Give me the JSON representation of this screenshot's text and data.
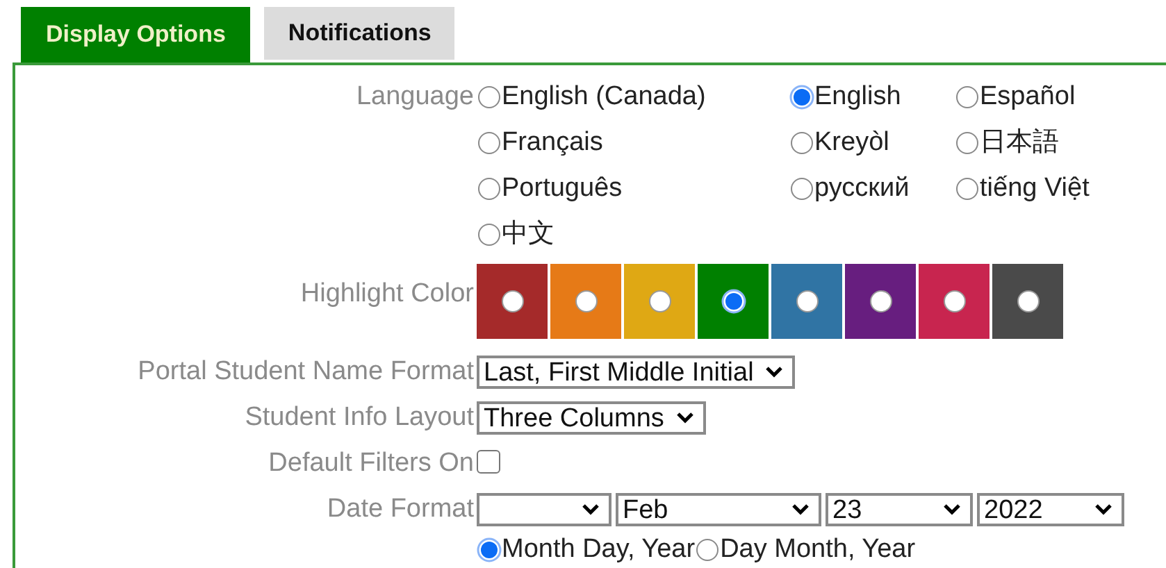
{
  "tabs": [
    {
      "label": "Display Options",
      "selected": true
    },
    {
      "label": "Notifications",
      "selected": false
    }
  ],
  "fields": [
    {
      "kind": "radio_group",
      "label": "Language",
      "options": [
        {
          "label": "English (Canada)",
          "selected": false
        },
        {
          "label": "English",
          "selected": true
        },
        {
          "label": "Español",
          "selected": false
        },
        {
          "label": "Français",
          "selected": false
        },
        {
          "label": "Kreyòl",
          "selected": false
        },
        {
          "label": "日本語",
          "selected": false
        },
        {
          "label": "Português",
          "selected": false
        },
        {
          "label": "русский",
          "selected": false
        },
        {
          "label": "tiếng Việt",
          "selected": false
        },
        {
          "label": "中文",
          "selected": false
        }
      ]
    },
    {
      "kind": "swatches",
      "label": "Highlight Color",
      "options": [
        {
          "color": "#a52a2a",
          "selected": false
        },
        {
          "color": "#e67a17",
          "selected": false
        },
        {
          "color": "#dfa814",
          "selected": false
        },
        {
          "color": "#008000",
          "selected": true
        },
        {
          "color": "#3074a4",
          "selected": false
        },
        {
          "color": "#671e7f",
          "selected": false
        },
        {
          "color": "#c8254f",
          "selected": false
        },
        {
          "color": "#4a4a4a",
          "selected": false
        }
      ]
    },
    {
      "kind": "select",
      "label": "Portal Student Name Format",
      "value": "Last, First Middle Initial"
    },
    {
      "kind": "select",
      "label": "Student Info Layout",
      "value": "Three Columns"
    },
    {
      "kind": "checkbox",
      "label": "Default Filters On",
      "checked": false
    },
    {
      "kind": "date",
      "label": "Date Format",
      "selects": [
        {
          "empty": true
        },
        {
          "value": "Feb"
        },
        {
          "value": "23"
        },
        {
          "value": "2022"
        }
      ],
      "options": [
        {
          "label": "Month Day, Year",
          "selected": true
        },
        {
          "label": "Day Month, Year",
          "selected": false
        }
      ]
    }
  ]
}
